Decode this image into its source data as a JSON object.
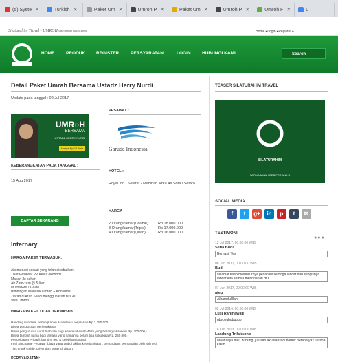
{
  "tabs": [
    {
      "label": "(5) Syste",
      "color": "#d33"
    },
    {
      "label": "Turkish",
      "color": "#4285f4"
    },
    {
      "label": "Paket Um",
      "color": "#999"
    },
    {
      "label": "Umroh P",
      "color": "#444"
    },
    {
      "label": "Paket Um",
      "color": "#e8a800"
    },
    {
      "label": "Umroh P",
      "color": "#444"
    },
    {
      "label": "Umroh F",
      "color": "#6a4"
    },
    {
      "label": "u",
      "color": "#4285f4"
    }
  ],
  "top": {
    "site_title": "Silaturahim Travel - UMROH",
    "site_sub": "sasu ummah mecca lunas",
    "links": "Home ▸Login ▸Register ▸"
  },
  "nav": {
    "items": [
      "HOME",
      "PRODUK",
      "REGISTER",
      "PERSYARATAN",
      "LOGIN",
      "HUBUNGI KAMI"
    ],
    "search": "Search"
  },
  "main": {
    "title": "Detail Paket Umrah Bersama Ustadz Herry Nurdi",
    "updated": "Update pada tanggal : 02 Jul 2017",
    "banner": {
      "title": "UMR◌H",
      "sub": "BERSAMA",
      "sub2": "USTADZ HERRY NURDI",
      "tag": "Hanya Rp 16 Juta"
    },
    "pesawat_label": "PESAWAT :",
    "airline": "Garuda Indonesia",
    "keberangkatan_label": "KEBERANGKATAN PADA TANGGAL :",
    "keberangkatan_value": "15 Agu 2017",
    "hotel_label": "HOTEL :",
    "hotel_value": "Royal Inn / Selaraf - Madinah Azka As Sofa / Setara",
    "harga_label": "HARGA :",
    "harga_items": [
      "2 Orang/kamar(Double)",
      "3 Orang/kamar(Triple)",
      "4 Orang/kamar(Quad)"
    ],
    "harga_values": [
      "Rp 18.000.000",
      "Rp 17.000.000",
      "Rp 16.000.000"
    ],
    "daftar_button": "DAFTAR SEKARANG",
    "internary": "Internary",
    "termasuk_title": "HARGA PAKET TERMASUK:",
    "termasuk_list": "Akomodasi sesuai yang telah disebutkan\nTiket Pesawat PP Kelas ekonomi\nMakan 3x sehari\nAir Zam-zam @ 5 liter\nMuthawwif / Guide\nBimbingan Manasik Umroh + Konsumsi\nZiarah di Arab Saudi menggunakan bus AC\nVisa Umroh",
    "tidak_title": "HARGA PAKET TIDAK TERMASUK:",
    "tidak_list": "Handling bandara, perlengkapan & asuransi perjalanan Rp 1.250.000\nBiaya pengurusan perlengkapan\nBiaya pengurusan surat mahram bagi wanita dibawah 45 th yang berangkat sendiri Rp. 300.000,-\nBiaya tambah nama bagi jamaah yang namanya belum tiga suku kata Rp. 250.000,-\nPengeluaran Pribadi, laundry, telp & kelebihan bagasi\nFuel Surcharge Pesawat (biaya yang timbul akibat keterlambatan, penundaan, pembatalan oleh airlines)\nTips untuk Guide, driver dan porter di airport",
    "persyaratan": "PERSYARATAN:"
  },
  "side": {
    "teaser_title": "TEASER SILATURAHIM TRAVEL",
    "teaser_caption": "SILATURAHIM",
    "teaser_caption2": "SARU UMMAH BEB PER AN I.C",
    "social_title": "SOCIAL MEDIA",
    "social": [
      {
        "icon": "f",
        "color": "#3b5998"
      },
      {
        "icon": "t",
        "color": "#1da1f2"
      },
      {
        "icon": "g+",
        "color": "#dd4b39"
      },
      {
        "icon": "in",
        "color": "#0077b5"
      },
      {
        "icon": "p",
        "color": "#cb2027"
      },
      {
        "icon": "t",
        "color": "#35465c"
      },
      {
        "icon": "✉",
        "color": "#aaa"
      }
    ],
    "testimoni_title": "TESTIMONI",
    "dots": "●●●",
    "testimoni": [
      {
        "date": "12 Jul 2017, 00:00:00 WIB",
        "name": "Setia Budi",
        "msg": "Berhasil Yes"
      },
      {
        "date": "08 Jun 2017, 00:00:00 WIB",
        "name": "Budi",
        "msg": "selamat telah meluncurnya pesan ini semoga lancar dan senpisnya lancar kita semua mendoakan mu"
      },
      {
        "date": "07 Jun 2017, 00:00:00 WIB",
        "name": "atep",
        "msg": "Alhamdulillah"
      },
      {
        "date": "02 Jul 2014, 00:00:00 WIB",
        "name": "Lusi Rahmawati",
        "msg": "gbvbvubububub"
      },
      {
        "date": "16 Okt 2013, 00:00:00 WIB",
        "name": "Landung Trilaksono",
        "msg": "Maaf saya mau hubungi jurusan akuntansi di nomer berapa ya? Terima kasih"
      }
    ]
  }
}
